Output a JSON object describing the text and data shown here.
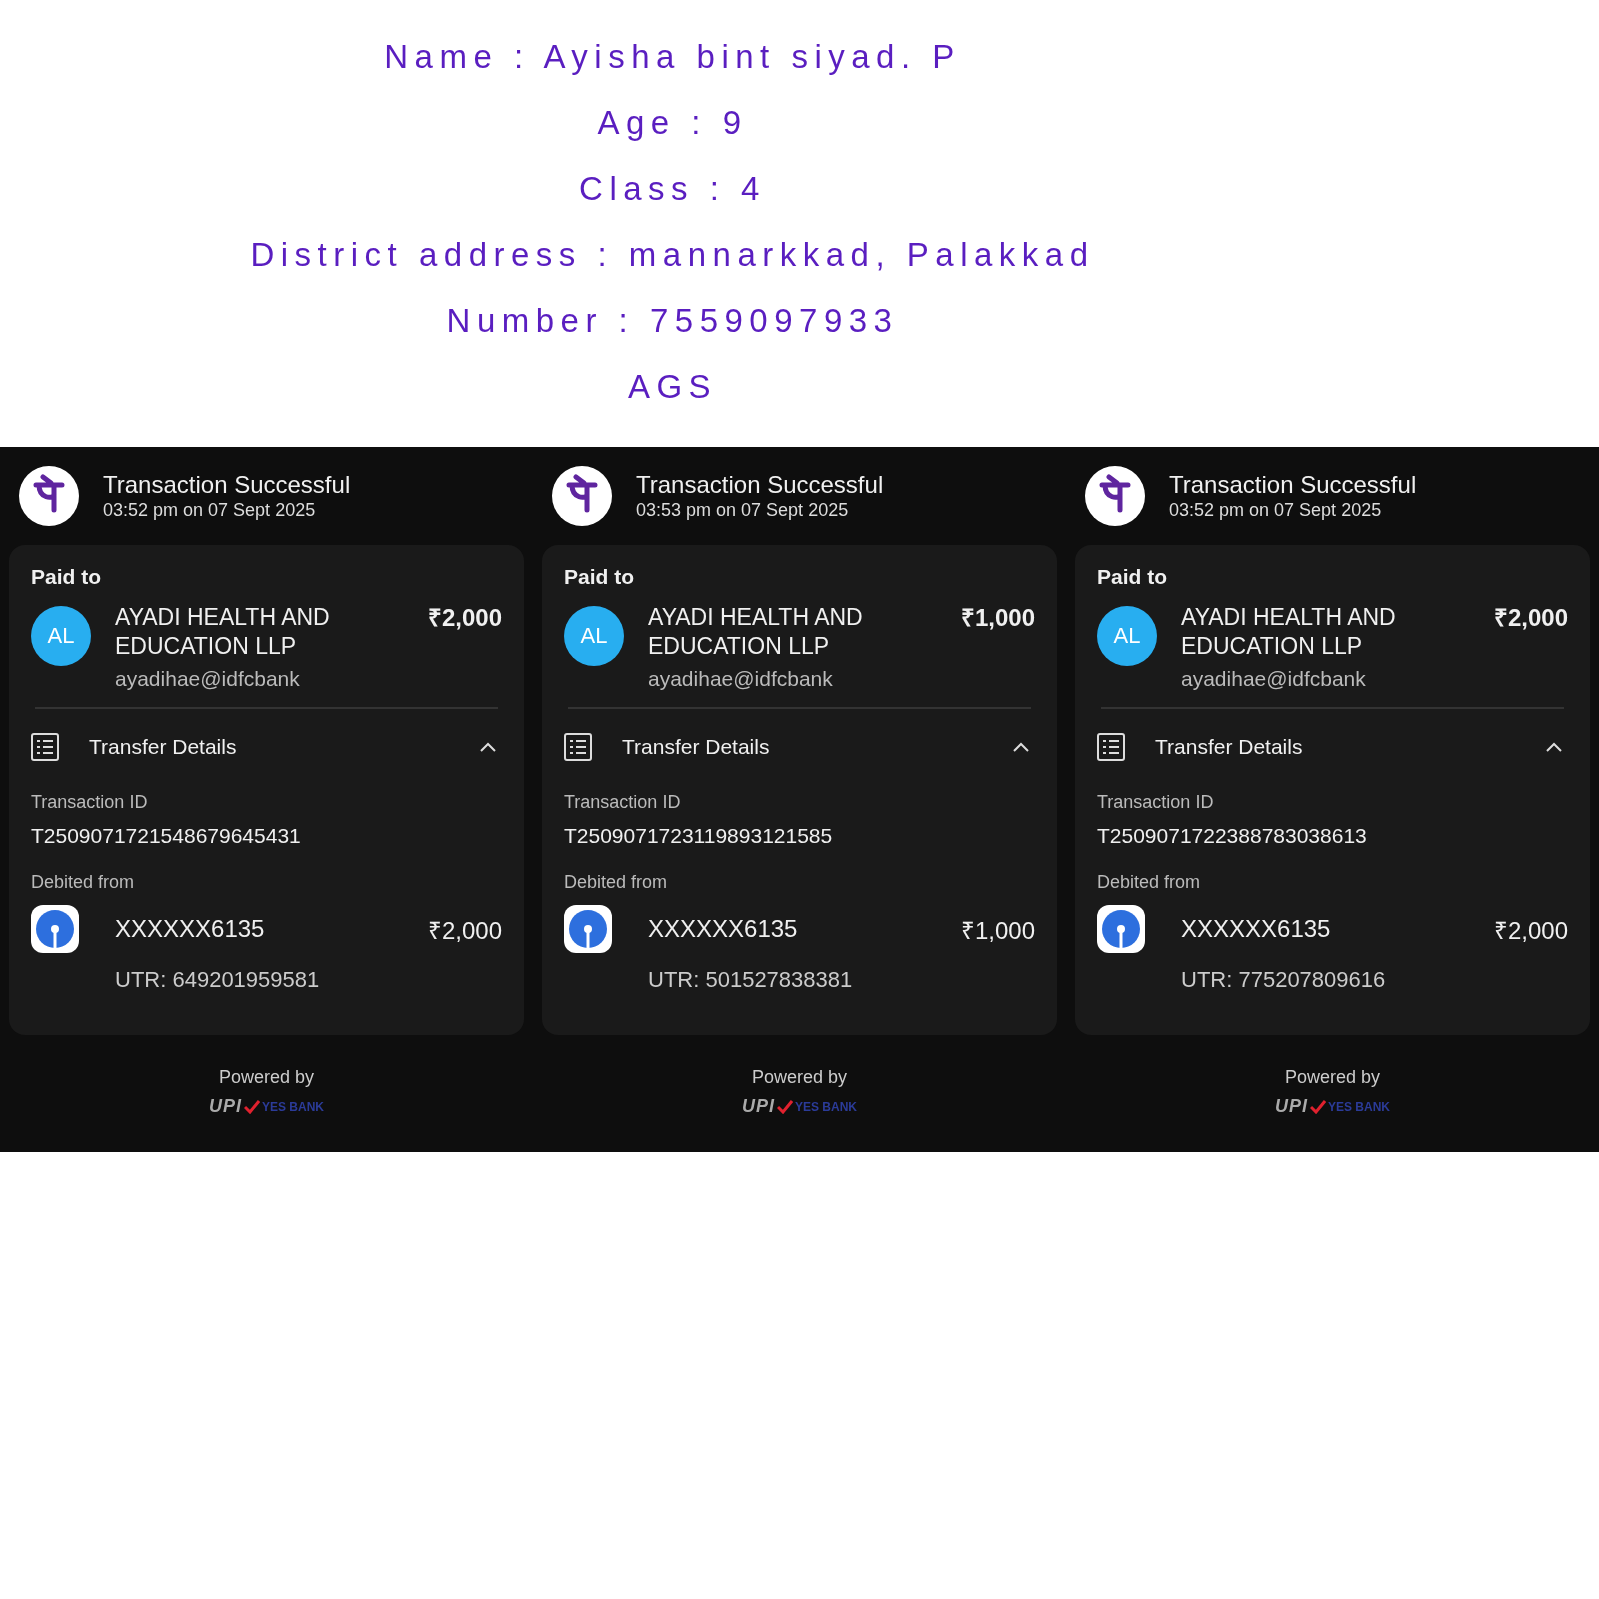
{
  "header_lines": [
    "Name : Ayisha bint siyad. P",
    "Age : 9",
    "Class : 4",
    "District address : mannarkkad, Palakkad",
    "Number : 7559097933",
    "AGS"
  ],
  "receipts": [
    {
      "status": "Transaction Successful",
      "timestamp": "03:52 pm on 07 Sept 2025",
      "paid_to_label": "Paid to",
      "avatar": "AL",
      "payee": "AYADI HEALTH AND EDUCATION LLP",
      "amount": "₹2,000",
      "vpa": "ayadihae@idfcbank",
      "details_label": "Transfer Details",
      "expanded": true,
      "txn_label": "Transaction ID",
      "txn_id": "T2509071721548679645431",
      "debit_label": "Debited from",
      "account": "XXXXXX6135",
      "debit_amount": "₹2,000",
      "utr": "UTR: 649201959581",
      "powered_by": "Powered by",
      "upi": "UPI",
      "bank": "YES BANK"
    },
    {
      "status": "Transaction Successful",
      "timestamp": "03:53 pm on 07 Sept 2025",
      "paid_to_label": "Paid to",
      "avatar": "AL",
      "payee": "AYADI HEALTH AND EDUCATION LLP",
      "amount": "₹1,000",
      "vpa": "ayadihae@idfcbank",
      "details_label": "Transfer Details",
      "expanded": true,
      "txn_label": "Transaction ID",
      "txn_id": "T2509071723119893121585",
      "debit_label": "Debited from",
      "account": "XXXXXX6135",
      "debit_amount": "₹1,000",
      "utr": "UTR: 501527838381",
      "powered_by": "Powered by",
      "upi": "UPI",
      "bank": "YES BANK"
    },
    {
      "status": "Transaction Successful",
      "timestamp": "03:52 pm on 07 Sept 2025",
      "paid_to_label": "Paid to",
      "avatar": "AL",
      "payee": "AYADI HEALTH AND EDUCATION LLP",
      "amount": "₹2,000",
      "vpa": "ayadihae@idfcbank",
      "details_label": "Transfer Details",
      "expanded": true,
      "txn_label": "Transaction ID",
      "txn_id": "T2509071722388783038613",
      "debit_label": "Debited from",
      "account": "XXXXXX6135",
      "debit_amount": "₹2,000",
      "utr": "UTR: 775207809616",
      "powered_by": "Powered by",
      "upi": "UPI",
      "bank": "YES BANK"
    }
  ]
}
